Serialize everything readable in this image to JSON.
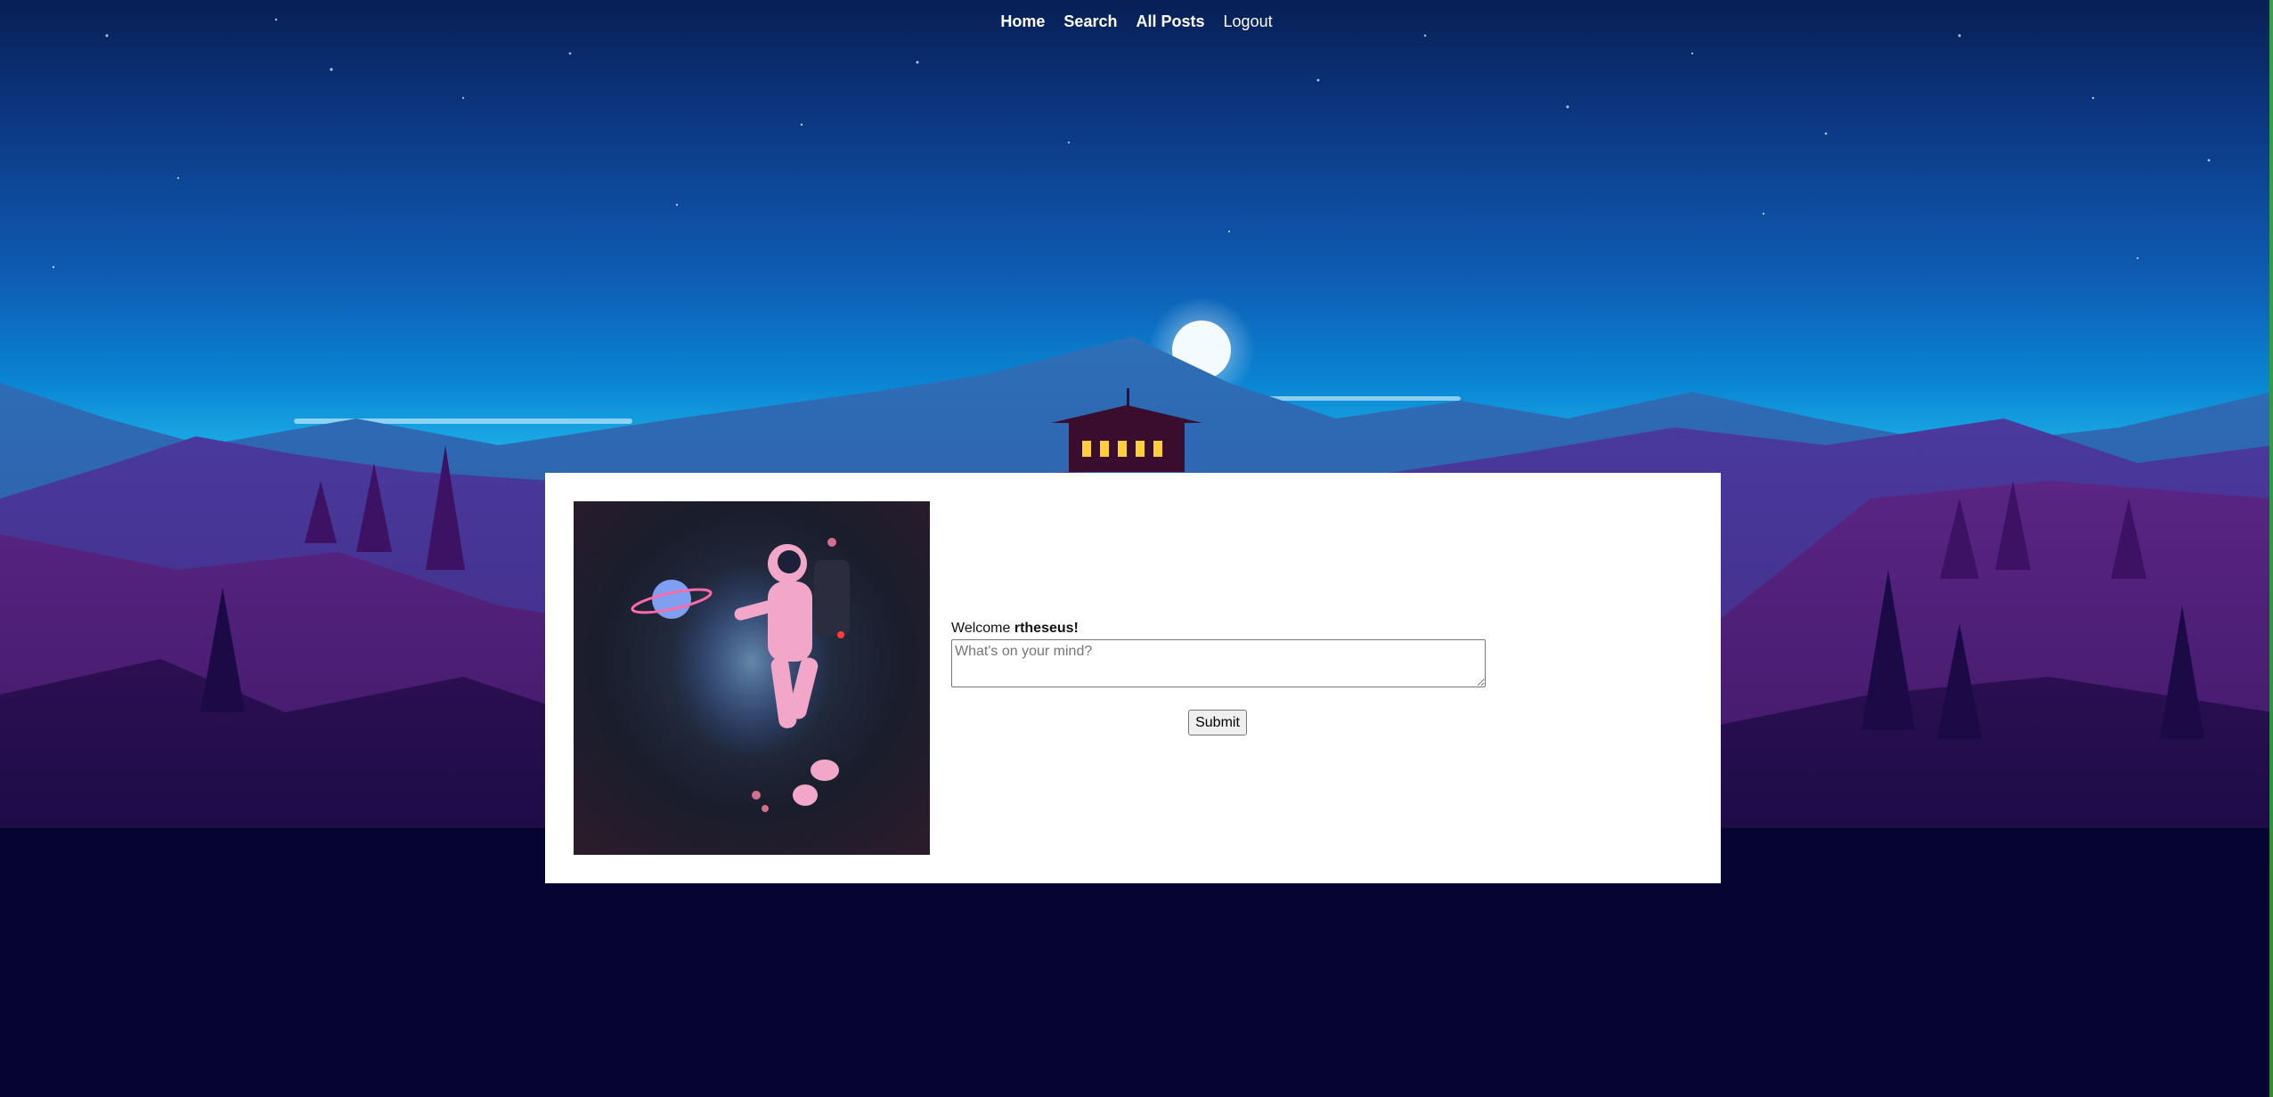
{
  "nav": {
    "items": [
      {
        "label": "Home"
      },
      {
        "label": "Search"
      },
      {
        "label": "All Posts"
      },
      {
        "label": "Logout"
      }
    ]
  },
  "welcome": {
    "prefix": "Welcome ",
    "username": "rtheseus!"
  },
  "post_form": {
    "placeholder": "What's on your mind?",
    "value": "",
    "submit_label": "Submit"
  },
  "colors": {
    "sky_top": "#0b2a6e",
    "sky_mid": "#0a7fd0",
    "panel": "#ffffff",
    "ground": "#050432"
  },
  "icons": {
    "avatar": "astronaut-with-planet-image",
    "background": "night-mountain-landscape-with-lookout-tower"
  }
}
